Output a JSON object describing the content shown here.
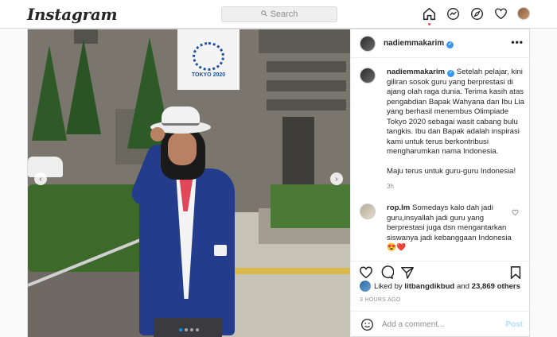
{
  "nav": {
    "logo": "Instagram",
    "search_placeholder": "Search",
    "icons": [
      "home-icon",
      "messenger-icon",
      "explore-icon",
      "heart-icon",
      "profile-avatar"
    ]
  },
  "post": {
    "photo_dots": 4,
    "active_dot": 1,
    "banner_text": "TOKYO 2020",
    "header": {
      "username": "nadiemmakarim",
      "more": "•••"
    },
    "caption": {
      "username": "nadiemmakarim",
      "text": "Setelah pelajar, kini giliran sosok guru yang berprestasi di ajang olah raga dunia. Terima kasih atas pengabdian Bapak Wahyana dan Ibu Lia yang berhasil menembus Olimpiade Tokyo 2020 sebagai wasit cabang bulu tangkis. Ibu dan Bapak adalah inspirasi kami untuk terus berkontribusi mengharumkan nama Indonesia.",
      "text2": "Maju terus untuk guru-guru Indonesia!",
      "time": "3h"
    },
    "comment": {
      "username": "rop.lm",
      "text": "Somedays kalo dah jadi guru,insyallah jadi guru yang berprestasi juga dsn mengantarkan siswanya jadi kebanggaan Indonesia",
      "emoji": "😍❤️"
    },
    "likes": {
      "liked_by_prefix": "Liked by",
      "liked_by_user": "litbangdikbud",
      "and": "and",
      "others": "23,869 others"
    },
    "time_ago": "3 HOURS AGO",
    "add_comment_placeholder": "Add a comment...",
    "post_button": "Post"
  },
  "colors": {
    "accent": "#0095f6",
    "verified": "#3897f0",
    "border": "#dbdbdb",
    "notification": "#ed4956"
  }
}
